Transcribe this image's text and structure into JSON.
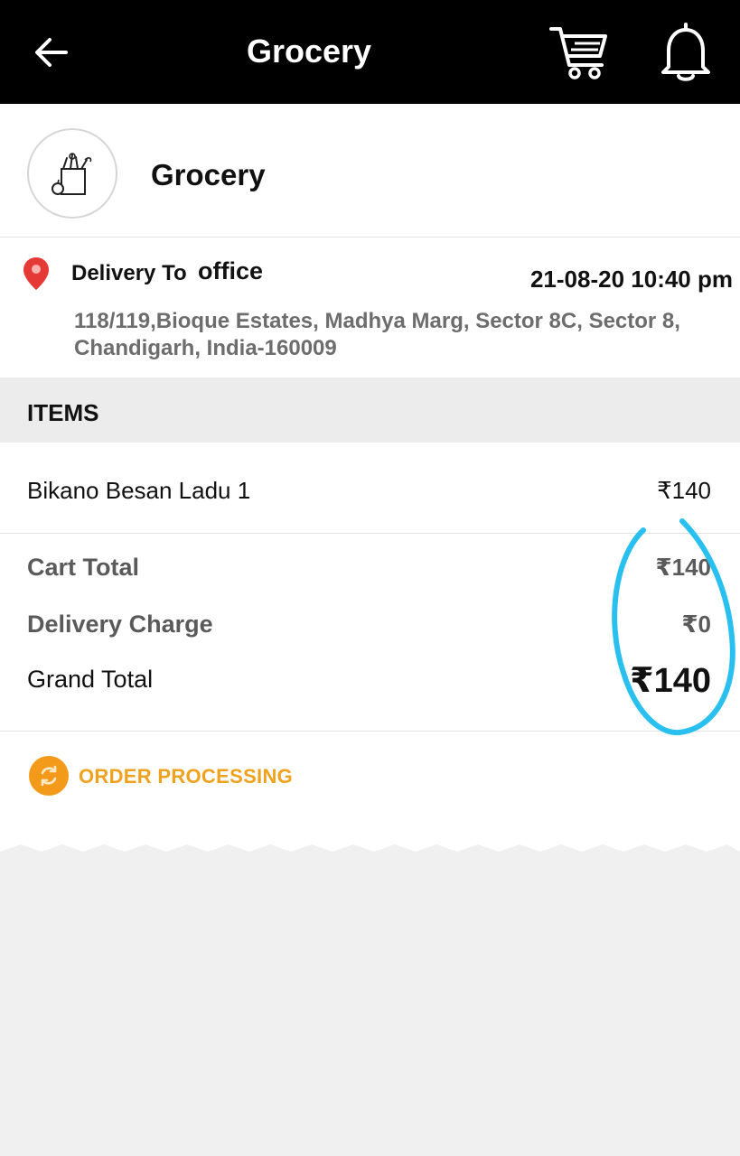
{
  "header": {
    "title": "Grocery",
    "back_icon": "arrow-left-icon",
    "cart_icon": "cart-icon",
    "notification_icon": "bell-icon"
  },
  "store": {
    "name": "Grocery",
    "logo_icon": "grocery-bag-icon"
  },
  "delivery": {
    "label": "Delivery To",
    "name": "office",
    "datetime": "21-08-20 10:40 pm",
    "address": "118/119,Bioque Estates, Madhya Marg, Sector 8C, Sector 8, Chandigarh, India-160009"
  },
  "items": {
    "heading": "ITEMS",
    "list": [
      {
        "name": "Bikano Besan Ladu 1",
        "price": "₹140"
      }
    ]
  },
  "totals": {
    "cart_total_label": "Cart Total",
    "cart_total": "₹140",
    "delivery_label": "Delivery Charge",
    "delivery": "₹0",
    "grand_total_label": "Grand Total",
    "grand_total": "₹140"
  },
  "status": {
    "text": "ORDER PROCESSING",
    "icon": "refresh-icon",
    "color": "#f39a1b"
  },
  "colors": {
    "header_bg": "#000000",
    "annotation": "#29c0f0",
    "pin": "#e53935"
  }
}
